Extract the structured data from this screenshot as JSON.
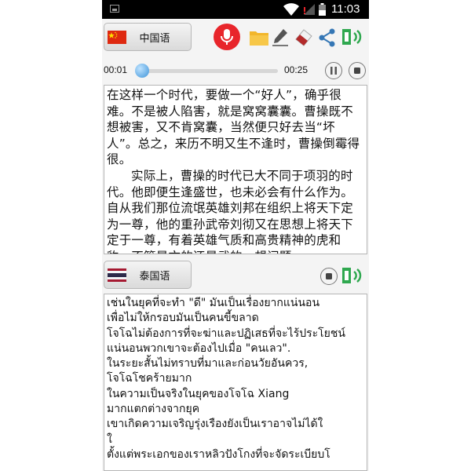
{
  "status_bar": {
    "time": "11:03"
  },
  "source": {
    "language_label": "中国语",
    "flag": "china-flag",
    "text": [
      "在这样一个时代，要做一个“好人”，确乎很难。不是被人陷害，就是窝窝囊囊。曹操既不想被害，又不肯窝囊，当然便只好去当“坏人”。总之，来历不明又生不逢时，曹操倒霉得很。",
      "实际上，曹操的时代已大不同于项羽的时代。他即便生逢盛世，也未必会有什么作为。自从我们那位流氓英雄刘邦在组织上将天下定为一尊，他的重孙武帝刘彻又在思想上将天下定于一尊，有着英雄气质和高贵精神的虎和豹，不管是文的还是武的，想问题"
    ]
  },
  "audio": {
    "elapsed": "00:01",
    "total": "00:25",
    "progress": 0.04
  },
  "toolbar": {
    "icons": [
      "microphone-icon",
      "folder-icon",
      "pencil-icon",
      "eraser-icon",
      "share-icon",
      "speaker-icon"
    ]
  },
  "target": {
    "language_label": "泰国语",
    "flag": "thailand-flag",
    "text": [
      "เช่นในยุคที่จะทำ \"ดี\" มันเป็นเรื่องยากแน่นอน",
      "เพื่อไม่ให้กรอบมันเป็นคนขี้ขลาด",
      "โจโฉไม่ต้องการที่จะฆ่าและปฏิเสธที่จะไร้ประโยชน์แน่นอนพวกเขาจะต้องไปเมื่อ \"คนเลว\".",
      "ในระยะสั้นไม่ทราบที่มาและก่อนวัยอันควร,",
      "โจโฉโชคร้ายมาก",
      "ในความเป็นจริงในยุคของโจโฉ Xiang",
      "มากแตกต่างจากยุค",
      "เขาเกิดความเจริญรุ่งเรืองยังเป็นเราอาจไม่ได้ใ",
      "ใ",
      "ตั้งแต่พระเอกของเราหลิวปังโกงที่จะจัดระเบียบโ"
    ]
  },
  "colors": {
    "mic": "#e8252b",
    "speaker": "#2fa84f",
    "share": "#3577b5",
    "folder": "#f2b62b"
  }
}
